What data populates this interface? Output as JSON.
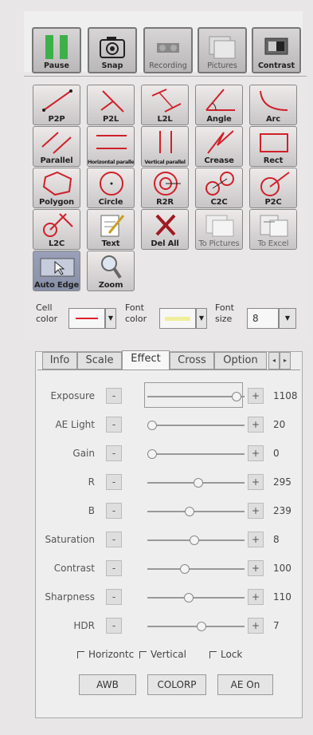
{
  "toolbar": {
    "buttons": [
      {
        "label": "Pause",
        "icon": "pause-icon"
      },
      {
        "label": "Snap",
        "icon": "camera-icon"
      },
      {
        "label": "Recording",
        "icon": "record-icon"
      },
      {
        "label": "Pictures",
        "icon": "pictures-icon"
      },
      {
        "label": "Contrast",
        "icon": "contrast-icon"
      }
    ]
  },
  "tools": [
    {
      "label": "P2P"
    },
    {
      "label": "P2L"
    },
    {
      "label": "L2L"
    },
    {
      "label": "Angle"
    },
    {
      "label": "Arc"
    },
    {
      "label": "Parallel"
    },
    {
      "label": "Horizontal parallel"
    },
    {
      "label": "Vertical parallel"
    },
    {
      "label": "Crease"
    },
    {
      "label": "Rect"
    },
    {
      "label": "Polygon"
    },
    {
      "label": "Circle"
    },
    {
      "label": "R2R"
    },
    {
      "label": "C2C"
    },
    {
      "label": "P2C"
    },
    {
      "label": "L2C"
    },
    {
      "label": "Text"
    },
    {
      "label": "Del All"
    },
    {
      "label": "To Pictures"
    },
    {
      "label": "To Excel"
    },
    {
      "label": "Auto Edge"
    },
    {
      "label": "Zoom"
    }
  ],
  "style_row": {
    "cell_color_label": "Cell color",
    "cell_color": "#e0202a",
    "font_color_label": "Font color",
    "font_color": "#f0ee9a",
    "font_size_label": "Font size",
    "font_size_value": "8"
  },
  "settings": {
    "tabs": [
      "Info",
      "Scale",
      "Effect",
      "Cross",
      "Option"
    ],
    "active_tab": "Effect",
    "rows": [
      {
        "label": "Exposure",
        "value": "1108",
        "level": 0.95
      },
      {
        "label": "AE Light",
        "value": "20",
        "level": 0.0
      },
      {
        "label": "Gain",
        "value": "0",
        "level": 0.0
      },
      {
        "label": "R",
        "value": "295",
        "level": 0.52
      },
      {
        "label": "B",
        "value": "239",
        "level": 0.42
      },
      {
        "label": "Saturation",
        "value": "8",
        "level": 0.47
      },
      {
        "label": "Contrast",
        "value": "100",
        "level": 0.37
      },
      {
        "label": "Sharpness",
        "value": "110",
        "level": 0.41
      },
      {
        "label": "HDR",
        "value": "7",
        "level": 0.55
      }
    ],
    "minus_label": "-",
    "plus_label": "+",
    "checkboxes": [
      "Horizontc",
      "Vertical",
      "Lock"
    ],
    "buttons": [
      "AWB",
      "COLORP",
      "AE On"
    ]
  },
  "colors": {
    "pause_green": "#3db04a",
    "measure_red": "#d0202a",
    "accent_select": "#8f97b1"
  }
}
